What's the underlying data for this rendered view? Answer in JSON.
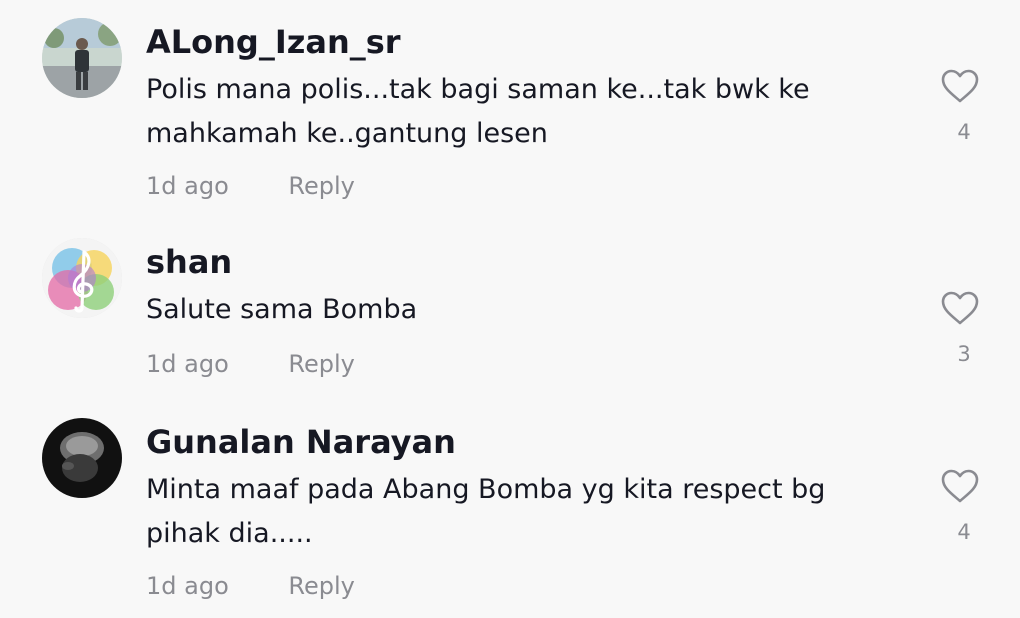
{
  "comments": [
    {
      "username": "ALong_Izan_sr",
      "text": "Polis mana polis...tak bagi saman ke...tak bwk ke mahkamah ke..gantung lesen",
      "time": "1d ago",
      "reply_label": "Reply",
      "likes": "4",
      "like_icon": "heart-outline-icon",
      "avatar": "person-standing-photo"
    },
    {
      "username": "shan",
      "text": "Salute sama Bomba",
      "time": "1d ago",
      "reply_label": "Reply",
      "likes": "3",
      "like_icon": "heart-outline-icon",
      "avatar": "treble-clef-watercolor"
    },
    {
      "username": "Gunalan Narayan",
      "text": "Minta maaf pada Abang Bomba yg kita respect bg pihak dia.....",
      "time": "1d ago",
      "reply_label": "Reply",
      "likes": "4",
      "like_icon": "heart-outline-icon",
      "avatar": "dark-portrait-photo"
    }
  ],
  "colors": {
    "background": "#f8f8f8",
    "username": "#161823",
    "text": "#161823",
    "secondary": "#8a8b91"
  }
}
